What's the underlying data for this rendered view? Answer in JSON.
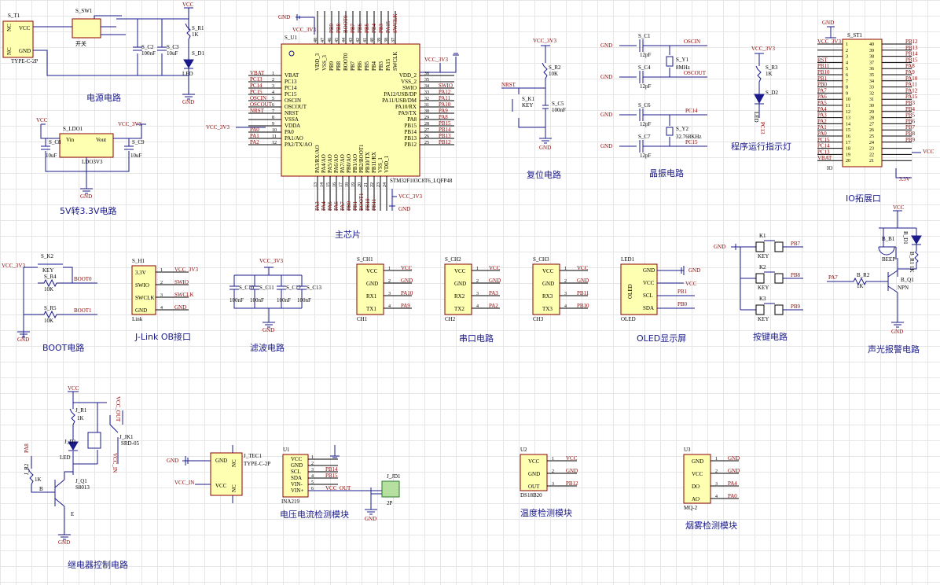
{
  "titles": {
    "power": "电源电路",
    "ldo": "5V转3.3V电路",
    "mcu": "主芯片",
    "reset": "复位电路",
    "crystal": "晶振电路",
    "run_led": "程序运行指示灯",
    "io": "IO拓展口",
    "boot": "BOOT电路",
    "jlink": "J-Link OB接口",
    "filter": "滤波电路",
    "uart": "串口电路",
    "oled": "OLED显示屏",
    "keys": "按键电路",
    "alarm": "声光报警电路",
    "relay": "继电器控制电路",
    "ina": "电压电流检测模块",
    "temp": "温度检测模块",
    "smoke": "烟雾检测模块"
  },
  "power": {
    "conn_ref": "S_T1",
    "conn_type": "TYPE-C-2P",
    "vcc": "VCC",
    "gnd": "GND",
    "nc": "NC",
    "sw_ref": "S_SW1",
    "sw_lbl": "开关",
    "c2_ref": "S_C2",
    "c2_val": "100nF",
    "c3_ref": "S_C3",
    "c3_val": "10uF",
    "r1_ref": "S_R1",
    "r1_val": "1K",
    "d1_ref": "S_D1",
    "d1_val": "LED",
    "vcc_net": "VCC",
    "gnd_net": "GND"
  },
  "ldo": {
    "ref": "S_LDO1",
    "part": "LDO3V3",
    "vin": "Vin",
    "vout": "Vout",
    "gnd": "GND",
    "c8_ref": "S_C8",
    "c8_val": "10uF",
    "c9_ref": "S_C9",
    "c9_val": "10uF",
    "vcc_net": "VCC",
    "vcc33_net": "VCC_3V3",
    "gnd_net": "GND"
  },
  "mcu": {
    "ref": "S_U1",
    "part": "STM32F103C8T6_LQFP48",
    "left_pins": [
      {
        "net": "VBAT",
        "name": "VBAT",
        "num": "1"
      },
      {
        "net": "PC13",
        "name": "PC13",
        "num": "2"
      },
      {
        "net": "PC14",
        "name": "PC14",
        "num": "3"
      },
      {
        "net": "PC15",
        "name": "PC15",
        "num": "4"
      },
      {
        "net": "OSCIN",
        "name": "OSCIN",
        "num": "5"
      },
      {
        "net": "OSCOUT",
        "name": "OSCOUT",
        "num": "6"
      },
      {
        "net": "NRST",
        "name": "NRST",
        "num": "7"
      },
      {
        "net": "",
        "name": "VSSA",
        "num": "8"
      },
      {
        "net": "",
        "name": "VDDA",
        "num": "9"
      },
      {
        "net": "PA0",
        "name": "PA0",
        "num": "10"
      },
      {
        "net": "PA1",
        "name": "PA1/AO",
        "num": "11"
      },
      {
        "net": "PA2",
        "name": "PA2/TX/AO",
        "num": "12"
      }
    ],
    "right_pins": [
      {
        "net": "",
        "name": "VDD_2",
        "num": "36"
      },
      {
        "net": "",
        "name": "VSS_2",
        "num": "35"
      },
      {
        "net": "SWIO",
        "name": "SWIO",
        "num": "34"
      },
      {
        "net": "PA12",
        "name": "PA12/USB/DP",
        "num": "33"
      },
      {
        "net": "PA11",
        "name": "PA11/USB/DM",
        "num": "32"
      },
      {
        "net": "PA10",
        "name": "PA10/RX",
        "num": "31"
      },
      {
        "net": "PA9",
        "name": "PA9/TX",
        "num": "30"
      },
      {
        "net": "PA8",
        "name": "PA8",
        "num": "29"
      },
      {
        "net": "PB15",
        "name": "PB15",
        "num": "28"
      },
      {
        "net": "PB14",
        "name": "PB14",
        "num": "27"
      },
      {
        "net": "PB13",
        "name": "PB13",
        "num": "26"
      },
      {
        "net": "PB12",
        "name": "PB12",
        "num": "25"
      }
    ],
    "top_pins": [
      "VDD_3",
      "VSS_3",
      "PB9",
      "PB8",
      "BOOT0",
      "PB7",
      "PB6",
      "PB5",
      "PB4",
      "PB3",
      "PA15",
      "SWCLK"
    ],
    "top_nums": [
      "48",
      "47",
      "46",
      "45",
      "44",
      "43",
      "42",
      "41",
      "40",
      "39",
      "38",
      "37"
    ],
    "top_nets": [
      "",
      "",
      "PB9",
      "PB8",
      "BOOT0",
      "PB7",
      "PB6",
      "PB5",
      "PB4",
      "PB3",
      "PA15",
      "SWCLK"
    ],
    "bottom_pins": [
      "PA3/RX/AO",
      "PA4/AO",
      "PA5/AO",
      "PA6/AO",
      "PA7/AO",
      "PB0/AO",
      "PB1/AO",
      "PB2/BOOT1",
      "PB10/TX",
      "PB11/RX",
      "VSS_1",
      "VDD_1"
    ],
    "bottom_nums": [
      "13",
      "14",
      "15",
      "16",
      "17",
      "18",
      "19",
      "20",
      "21",
      "22",
      "23",
      "24"
    ],
    "bottom_nets": [
      "PA3",
      "PA4",
      "PA5",
      "PA6",
      "PA7",
      "PB0",
      "PB1",
      "BOOT1",
      "PB10",
      "PB11",
      "",
      ""
    ],
    "vcc33_left": "VCC_3V3",
    "vcc33_top": "VCC_3V3",
    "vcc33_right": "VCC_3V3",
    "vcc33_bottom": "VCC_3V3",
    "gnd": "GND"
  },
  "reset": {
    "vcc": "VCC_3V3",
    "r_ref": "S_R2",
    "r_val": "10K",
    "k_ref": "S_K1",
    "k_val": "KEY",
    "c_ref": "S_C5",
    "c_val": "100nF",
    "nrst": "NRST",
    "gnd": "GND"
  },
  "crystal": {
    "c1_ref": "S_C1",
    "c1_val": "12pF",
    "c4_ref": "S_C4",
    "c4_val": "12pF",
    "y1_ref": "S_Y1",
    "y1_val": "8MHz",
    "c6_ref": "S_C6",
    "c6_val": "12pF",
    "c7_ref": "S_C7",
    "c7_val": "12pF",
    "y2_ref": "S_Y2",
    "y2_val": "32.768KHz",
    "oscin": "OSCIN",
    "oscout": "OSCOUT",
    "pc14": "PC14",
    "pc15": "PC15",
    "gnd": "GND"
  },
  "run_led": {
    "vcc": "VCC_3V3",
    "r_ref": "S_R3",
    "r_val": "1K",
    "d_ref": "S_D2",
    "d_val": "LED",
    "net": "PC13"
  },
  "io": {
    "ref": "S_ST1",
    "part": "IO",
    "gnd": "GND",
    "vcc33": "VCC_3V3",
    "vcc": "VCC",
    "v33": "3.3V",
    "rows": [
      {
        "l": "",
        "ln": "1",
        "rn": "40",
        "r": "PB12"
      },
      {
        "l": "",
        "ln": "2",
        "rn": "39",
        "r": "PB13"
      },
      {
        "l": "",
        "ln": "3",
        "rn": "38",
        "r": "PB14"
      },
      {
        "l": "RST",
        "ln": "4",
        "rn": "37",
        "r": "PB15"
      },
      {
        "l": "PB11",
        "ln": "5",
        "rn": "36",
        "r": "PA8"
      },
      {
        "l": "PB10",
        "ln": "6",
        "rn": "35",
        "r": "PA9"
      },
      {
        "l": "PB1",
        "ln": "7",
        "rn": "34",
        "r": "PA10"
      },
      {
        "l": "PB0",
        "ln": "8",
        "rn": "33",
        "r": "PA11"
      },
      {
        "l": "PA7",
        "ln": "9",
        "rn": "32",
        "r": "PA12"
      },
      {
        "l": "PA6",
        "ln": "10",
        "rn": "31",
        "r": "PA15"
      },
      {
        "l": "PA5",
        "ln": "11",
        "rn": "30",
        "r": "PB3"
      },
      {
        "l": "PA4",
        "ln": "12",
        "rn": "29",
        "r": "PB4"
      },
      {
        "l": "PA3",
        "ln": "13",
        "rn": "28",
        "r": "PB5"
      },
      {
        "l": "PA2",
        "ln": "14",
        "rn": "27",
        "r": "PB6"
      },
      {
        "l": "PA1",
        "ln": "15",
        "rn": "26",
        "r": "PB7"
      },
      {
        "l": "PA0",
        "ln": "16",
        "rn": "25",
        "r": "PB8"
      },
      {
        "l": "PC15",
        "ln": "17",
        "rn": "24",
        "r": "PB9"
      },
      {
        "l": "PC14",
        "ln": "18",
        "rn": "23",
        "r": ""
      },
      {
        "l": "PC13",
        "ln": "19",
        "rn": "22",
        "r": ""
      },
      {
        "l": "VBAT",
        "ln": "20",
        "rn": "21",
        "r": ""
      }
    ]
  },
  "boot": {
    "vcc": "VCC_3V3",
    "k_ref": "S_K2",
    "k_val": "KEY",
    "r4_ref": "S_R4",
    "r4_val": "10K",
    "r5_ref": "S_R5",
    "r5_val": "10K",
    "boot0": "BOOT0",
    "boot1": "BOOT1",
    "gnd": "GND"
  },
  "jlink": {
    "ref": "S_H1",
    "part": "Link",
    "pins": [
      {
        "n": "3.3V",
        "num": "1",
        "net": "VCC_3V3"
      },
      {
        "n": "SWIO",
        "num": "2",
        "net": "SWIO"
      },
      {
        "n": "SWCLK",
        "num": "3",
        "net": "SWCLK"
      },
      {
        "n": "GND",
        "num": "4",
        "net": "GND"
      }
    ]
  },
  "filter": {
    "vcc": "VCC_3V3",
    "caps": [
      {
        "ref": "S_C10",
        "val": "100nF"
      },
      {
        "ref": "S_C11",
        "val": "100nF"
      },
      {
        "ref": "S_C12",
        "val": "100nF"
      },
      {
        "ref": "S_C13",
        "val": "100nF"
      }
    ],
    "gnd": "GND"
  },
  "uart": [
    {
      "ref": "S_CH1",
      "part": "CH1",
      "rx": "RX1",
      "tx": "TX1",
      "rxnet": "PA10",
      "txnet": "PA9"
    },
    {
      "ref": "S_CH2",
      "part": "CH2",
      "rx": "RX2",
      "tx": "TX2",
      "rxnet": "PA3",
      "txnet": "PA2"
    },
    {
      "ref": "S_CH3",
      "part": "CH3",
      "rx": "RX3",
      "tx": "TX3",
      "rxnet": "PB11",
      "txnet": "PB10"
    }
  ],
  "uart_common": {
    "vcc": "VCC",
    "gnd": "GND",
    "vcc_net": "VCC",
    "gnd_net": "GND"
  },
  "oled": {
    "ref": "LED1",
    "part": "OLED",
    "body": "OLED",
    "gnd": "GND",
    "vcc": "VCC",
    "scl": "SCL",
    "sda": "SDA",
    "gnd_net": "GND",
    "vcc_net": "VCC",
    "scl_net": "PB1",
    "sda_net": "PB0"
  },
  "keys": {
    "gnd": "GND",
    "items": [
      {
        "ref": "K1",
        "val": "KEY",
        "net": "PB7"
      },
      {
        "ref": "K2",
        "val": "KEY",
        "net": "PB8"
      },
      {
        "ref": "K3",
        "val": "KEY",
        "net": "PB9"
      }
    ]
  },
  "alarm": {
    "vcc": "VCC",
    "b_ref": "B_B1",
    "b_val": "BEEP",
    "d_ref": "B_D1",
    "r1_ref": "B_R1",
    "r1_val": "1K",
    "r2_ref": "B_R2",
    "r2_val": "1K",
    "q_ref": "B_Q1",
    "q_val": "NPN",
    "net": "PA7",
    "gnd": "GND"
  },
  "relay": {
    "vcc": "VCC",
    "r1_ref": "J_R1",
    "r1_val": "1K",
    "d_ref": "J_D1",
    "d_val": "LED",
    "jk_ref": "J_JK1",
    "jk_val": "SRD-05",
    "out": "VCC_OUT",
    "in": "VCC_IN",
    "r2_ref": "J_R2",
    "r2_val": "1K",
    "q_ref": "J_Q1",
    "q_val": "S8013",
    "net": "PA8",
    "b": "B",
    "e": "E",
    "gnd": "GND"
  },
  "tec": {
    "ref": "J_TEC1",
    "part": "TYPE-C-2P",
    "gnd": "GND",
    "vcc": "VCC",
    "nc": "NC",
    "gnd_net": "GND",
    "vin": "VCC_IN"
  },
  "ina": {
    "ref": "U1",
    "part": "INA219",
    "pins": [
      "VCC",
      "GND",
      "SCL",
      "SDA",
      "VIN-",
      "VIN+"
    ],
    "nets": [
      "",
      "",
      "PB14",
      "PB15",
      "",
      "VCC_OUT"
    ],
    "jd_ref": "J_JD1",
    "jd_val": "2P",
    "gnd": "GND"
  },
  "ds18": {
    "ref": "U2",
    "part": "DS18B20",
    "pins": [
      "VCC",
      "GND",
      "OUT"
    ],
    "nets": [
      "VCC",
      "GND",
      "PB12"
    ]
  },
  "mq2": {
    "ref": "U3",
    "part": "MQ-2",
    "pins": [
      "GND",
      "VCC",
      "DO",
      "AO"
    ],
    "nets": [
      "GND",
      "GND",
      "PA4",
      "PA0"
    ]
  }
}
